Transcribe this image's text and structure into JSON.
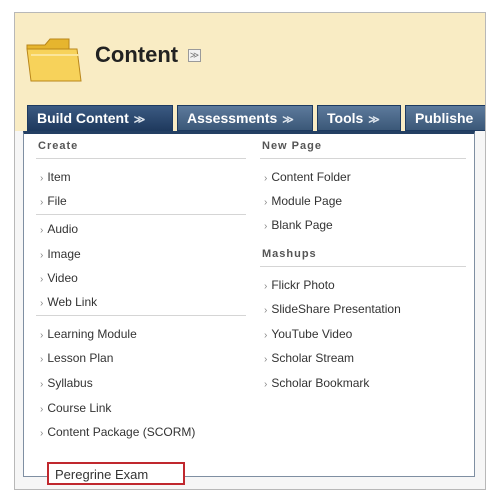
{
  "header": {
    "title": "Content"
  },
  "tabs": [
    {
      "label": "Build Content",
      "chevron": "≫"
    },
    {
      "label": "Assessments",
      "chevron": "≫"
    },
    {
      "label": "Tools",
      "chevron": "≫"
    },
    {
      "label": "Publishe",
      "chevron": ""
    }
  ],
  "create": {
    "heading": "Create",
    "items": [
      "Item",
      "File",
      "Audio",
      "Image",
      "Video",
      "Web Link",
      "Learning Module",
      "Lesson Plan",
      "Syllabus",
      "Course Link",
      "Content Package (SCORM)"
    ],
    "highlighted_item": "Peregrine Exam"
  },
  "new_page": {
    "heading": "New Page",
    "items": [
      "Content Folder",
      "Module Page",
      "Blank Page"
    ]
  },
  "mashups": {
    "heading": "Mashups",
    "items": [
      "Flickr Photo",
      "SlideShare Presentation",
      "YouTube Video",
      "Scholar Stream",
      "Scholar Bookmark"
    ]
  },
  "colors": {
    "header_bg": "#f9ecc4",
    "tab_bg": "#3b5878",
    "highlight_border": "#c0282e"
  }
}
